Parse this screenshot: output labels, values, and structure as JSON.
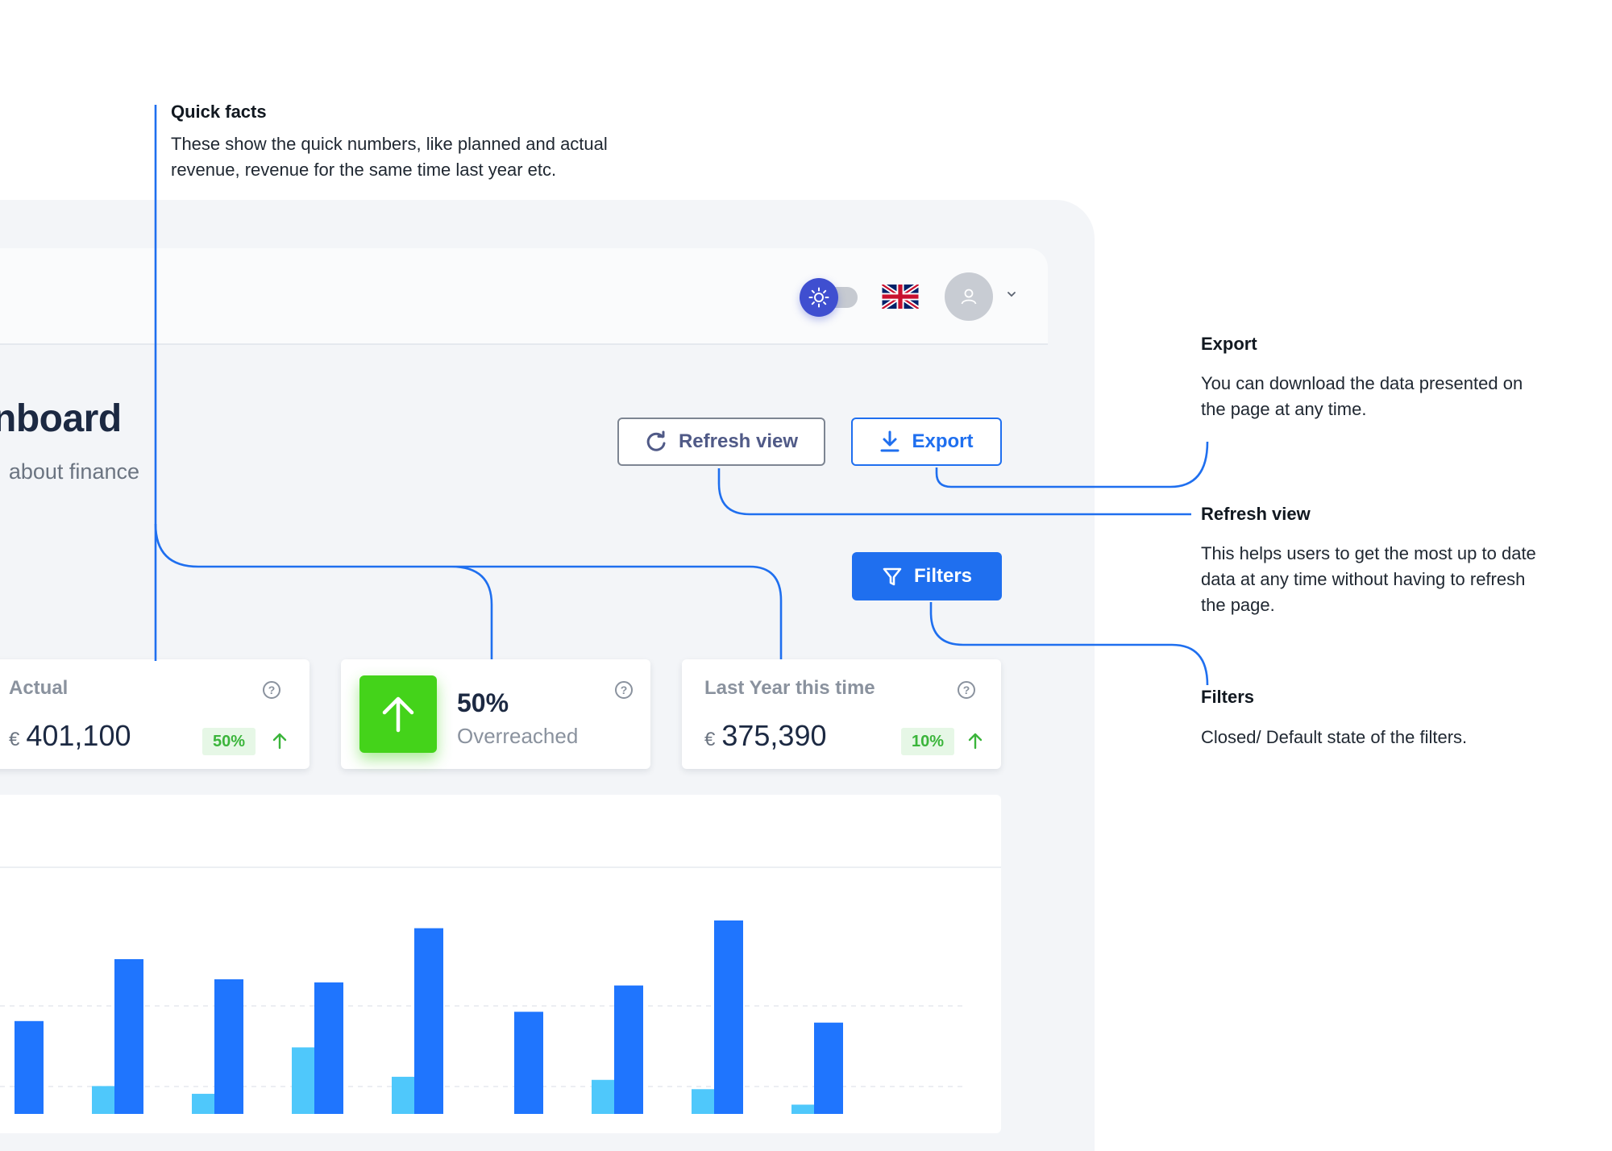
{
  "annotations": {
    "quick_facts": {
      "title": "Quick facts",
      "text": "These show the quick numbers, like planned and actual revenue, revenue for the same time last year etc."
    },
    "export": {
      "title": "Export",
      "text": "You can download the data presented on the page at any time."
    },
    "refresh": {
      "title": "Refresh view",
      "text": "This helps users to get the most up to date data at any time without having to refresh the page."
    },
    "filters": {
      "title": "Filters",
      "text": "Closed/ Default state of the filters."
    }
  },
  "header": {
    "theme_toggle_icon": "sun-icon",
    "language_flag": "uk-flag",
    "avatar_icon": "user-icon",
    "avatar_menu_icon": "chevron-down-icon"
  },
  "page": {
    "title": "nboard",
    "subtitle": "about finance"
  },
  "toolbar": {
    "refresh_label": "Refresh view",
    "export_label": "Export",
    "filters_label": "Filters"
  },
  "cards": {
    "actual": {
      "label": "Actual",
      "currency": "€",
      "value": "401,100",
      "change": "50%",
      "trend": "up"
    },
    "overreached": {
      "value": "50%",
      "label": "Overreached"
    },
    "last_year": {
      "label": "Last Year this time",
      "currency": "€",
      "value": "375,390",
      "change": "10%",
      "trend": "up"
    }
  },
  "colors": {
    "accent": "#1f6fef",
    "success": "#44d31a",
    "bar_primary": "#1f75fe",
    "bar_secondary": "#4fc8fb",
    "annotation_line": "#1f6fef"
  },
  "chart_data": {
    "type": "bar",
    "series": [
      {
        "values": [
          null,
          18,
          13,
          43,
          24,
          0,
          22,
          16,
          6
        ]
      },
      {
        "values": [
          60,
          100,
          87,
          85,
          120,
          66,
          83,
          125,
          59
        ]
      }
    ]
  }
}
